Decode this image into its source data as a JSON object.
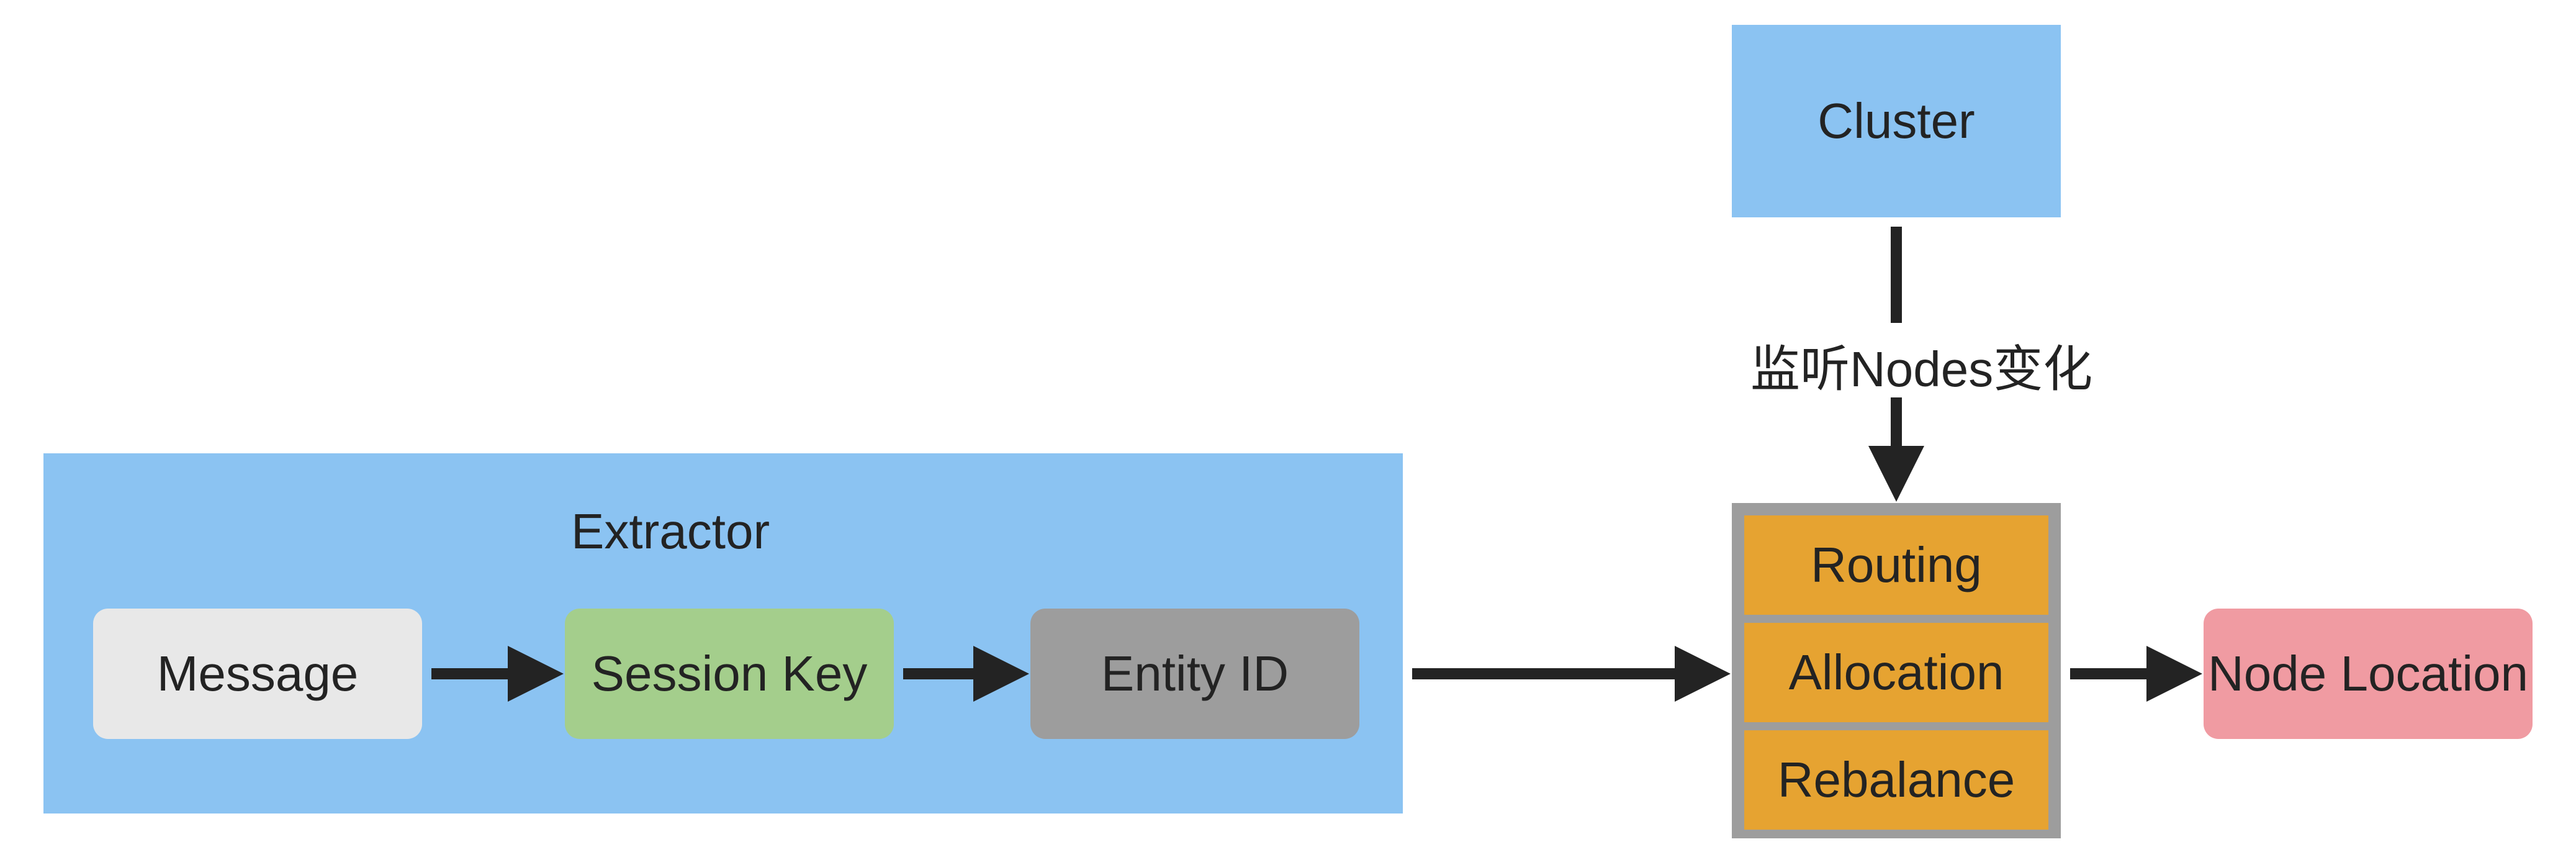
{
  "extractor": {
    "title": "Extractor",
    "message": "Message",
    "session": "Session Key",
    "entity": "Entity ID"
  },
  "cluster": {
    "label": "Cluster"
  },
  "stack": {
    "routing": "Routing",
    "allocation": "Allocation",
    "rebalance": "Rebalance"
  },
  "node": {
    "label": "Node Location"
  },
  "edges": {
    "cluster_to_stack": "监听Nodes变化"
  },
  "colors": {
    "blue": "#8bc3f2",
    "green": "#a4ce8c",
    "lightgray": "#e8e8e8",
    "gray": "#9d9d9d",
    "orange": "#e6a331",
    "pink": "#f09ba2",
    "stroke": "#232323"
  }
}
